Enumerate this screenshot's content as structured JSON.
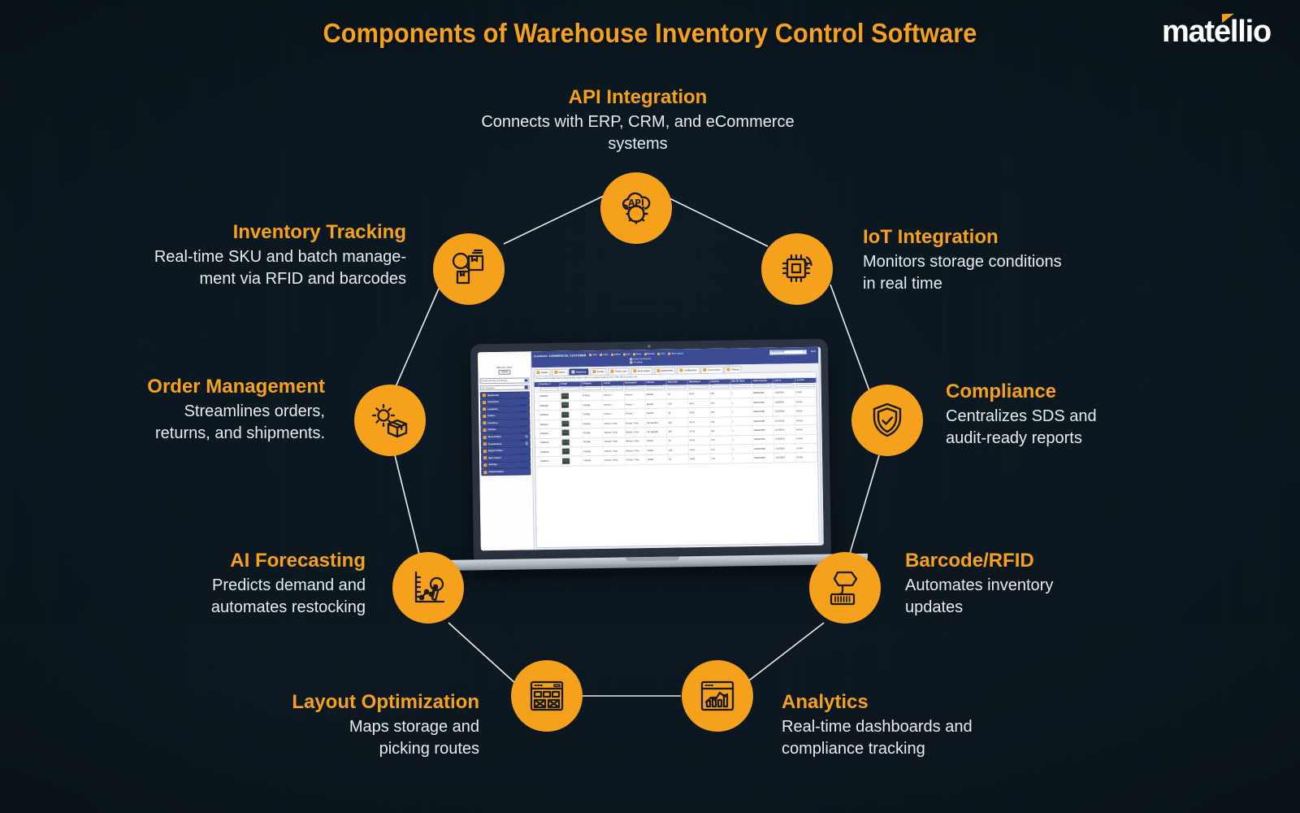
{
  "header": {
    "title": "Components of Warehouse Inventory Control Software",
    "logo_text": "matellio"
  },
  "theme": {
    "accent": "#f5a11b",
    "background": "#12202b",
    "body_text": "#e8ecef",
    "app_blue": "#3b4b94"
  },
  "components": [
    {
      "id": "api-integration",
      "heading": "API Integration",
      "body": "Connects with ERP, CRM, and eCommerce systems",
      "icon": "cloud-api-gear-icon",
      "align": "center"
    },
    {
      "id": "inventory-tracking",
      "heading": "Inventory Tracking",
      "body": "Real-time SKU and batch manage-ment via RFID and barcodes",
      "body_line1": "Real-time SKU and batch manage-",
      "body_line2": "ment via RFID and barcodes",
      "icon": "magnifier-box-icon",
      "align": "right"
    },
    {
      "id": "iot-integration",
      "heading": "IoT Integration",
      "body": "Monitors storage conditions in real time",
      "body_line1": "Monitors storage conditions",
      "body_line2": "in real time",
      "icon": "microchip-wifi-icon",
      "align": "left"
    },
    {
      "id": "order-management",
      "heading": "Order Management",
      "body": "Streamlines orders, returns, and shipments.",
      "body_line1": "Streamlines orders,",
      "body_line2": "returns, and shipments.",
      "icon": "gear-package-icon",
      "align": "right"
    },
    {
      "id": "compliance",
      "heading": "Compliance",
      "body": "Centralizes SDS and audit-ready reports",
      "body_line1": "Centralizes SDS and",
      "body_line2": "audit-ready reports",
      "icon": "shield-check-icon",
      "align": "left"
    },
    {
      "id": "ai-forecasting",
      "heading": "AI Forecasting",
      "body": "Predicts demand and automates restocking",
      "body_line1": "Predicts demand and",
      "body_line2": "automates restocking",
      "icon": "chart-magnifier-icon",
      "align": "right"
    },
    {
      "id": "barcode-rfid",
      "heading": "Barcode/RFID",
      "body": "Automates inventory updates",
      "body_line1": "Automates inventory",
      "body_line2": "updates",
      "icon": "barcode-scanner-icon",
      "align": "left"
    },
    {
      "id": "layout-optimization",
      "heading": "Layout Optimization",
      "body": "Maps storage and picking routes",
      "body_line1": "Maps storage and",
      "body_line2": "picking routes",
      "icon": "wireframe-layout-icon",
      "align": "right"
    },
    {
      "id": "analytics",
      "heading": "Analytics",
      "body": "Real-time dashboards and compliance tracking",
      "body_line1": "Real-time dashboards and",
      "body_line2": "compliance tracking",
      "icon": "dashboard-chart-icon",
      "align": "left"
    }
  ],
  "laptop_app": {
    "customer_label": "Customer: COMMERCIAL CUSTOMER",
    "toolbar_actions": [
      "New",
      "Clear",
      "Delete",
      "Exit",
      "More",
      "Refresh",
      "Grid",
      "Save Layout"
    ],
    "layout_select_value": "WAREHOUSE",
    "back_label": "Back",
    "checkboxes": [
      "Show Part Number",
      "Grouping"
    ],
    "sidebar": {
      "welcome": "Welcome, Store!",
      "logout_label": "Logout",
      "select_1": "Browse Routing and Storage",
      "select_2": "All Companies",
      "items": [
        {
          "label": "Dashboard",
          "expandable": false
        },
        {
          "label": "Customers",
          "expandable": false
        },
        {
          "label": "Locations",
          "expandable": false
        },
        {
          "label": "Orders",
          "expandable": false
        },
        {
          "label": "Inventory",
          "expandable": false
        },
        {
          "label": "Articles",
          "expandable": false
        },
        {
          "label": "Work Orders",
          "expandable": true
        },
        {
          "label": "Transactions",
          "expandable": true
        },
        {
          "label": "Report Center",
          "expandable": false
        },
        {
          "label": "Sync Center",
          "expandable": false
        },
        {
          "label": "Settings",
          "expandable": false
        },
        {
          "label": "Administration",
          "expandable": false
        }
      ]
    },
    "tabs": [
      {
        "label": "Details",
        "active": false
      },
      {
        "label": "Orders",
        "active": false
      },
      {
        "label": "Inventory",
        "active": true
      },
      {
        "label": "Articles",
        "active": false
      },
      {
        "label": "Portal Users",
        "active": false
      },
      {
        "label": "Work Orders",
        "active": false
      },
      {
        "label": "Attachments",
        "active": false
      },
      {
        "label": "Configuration",
        "active": false
      },
      {
        "label": "Cost Centers",
        "active": false
      },
      {
        "label": "Sharing",
        "active": false
      }
    ],
    "grid_hint": "Drag a column header here to group by that column. Click on a column header to sort. CTRL-click to remove sort.",
    "columns": [
      "Inventory #",
      "Image",
      "Category",
      "Article",
      "Description",
      "COLOR",
      "SIZE (US)",
      "Warehouse",
      "Location",
      "Qty On Hand",
      "Order Number",
      "Last In",
      "Last Out"
    ],
    "filter_placeholder": "Filter...",
    "rows": [
      [
        "0998530",
        "",
        "PHONE",
        "iPhone 7",
        "iPhone 7",
        "BLACK",
        "32",
        "W-01",
        "P05",
        "1",
        "GBOXP080",
        "5/12/2019",
        "(none)"
      ],
      [
        "0998538",
        "",
        "PHONE",
        "iPhone 7",
        "iPhone 7",
        "BLACK",
        "128",
        "W-01",
        "P05",
        "1",
        "GBOXP080",
        "5/12/2019",
        "(none)"
      ],
      [
        "0998542",
        "",
        "PHONE",
        "iPhone 7",
        "iPhone 7",
        "BLACK",
        "32",
        "W-01",
        "P05",
        "1",
        "GBOXP080",
        "5/12/2019",
        "(none)"
      ],
      [
        "0998547",
        "",
        "PHONE",
        "iPhone 7 Plus",
        "iPhone 7 Plus",
        "JET BLACK",
        "128",
        "W-01",
        "P11",
        "1",
        "GBOXP080",
        "5/12/2019",
        "(none)"
      ],
      [
        "0998551",
        "",
        "PHONE",
        "iPhone 7 Plus",
        "iPhone 7 Plus",
        "JET BLACK",
        "256",
        "W-01",
        "P11",
        "1",
        "GBOXP080",
        "5/12/2019",
        "(none)"
      ],
      [
        "0998556",
        "",
        "PHONE",
        "iPhone 7 Plus",
        "iPhone 7 Plus",
        "GOLD",
        "32",
        "W-01",
        "P11",
        "1",
        "GBOXP080",
        "5/12/2019",
        "(none)"
      ],
      [
        "0998563",
        "",
        "PHONE",
        "iPhone 7 Plus",
        "iPhone 7 Plus",
        "GOLD",
        "128",
        "W-01",
        "P11",
        "1",
        "GBOXP080",
        "5/12/2019",
        "(none)"
      ],
      [
        "0998571",
        "",
        "PHONE",
        "iPhone 7 Plus",
        "iPhone 7 Plus",
        "ROSE",
        "32",
        "W-01",
        "P11",
        "1",
        "GBOXP080",
        "5/12/2019",
        "(none)"
      ]
    ]
  }
}
